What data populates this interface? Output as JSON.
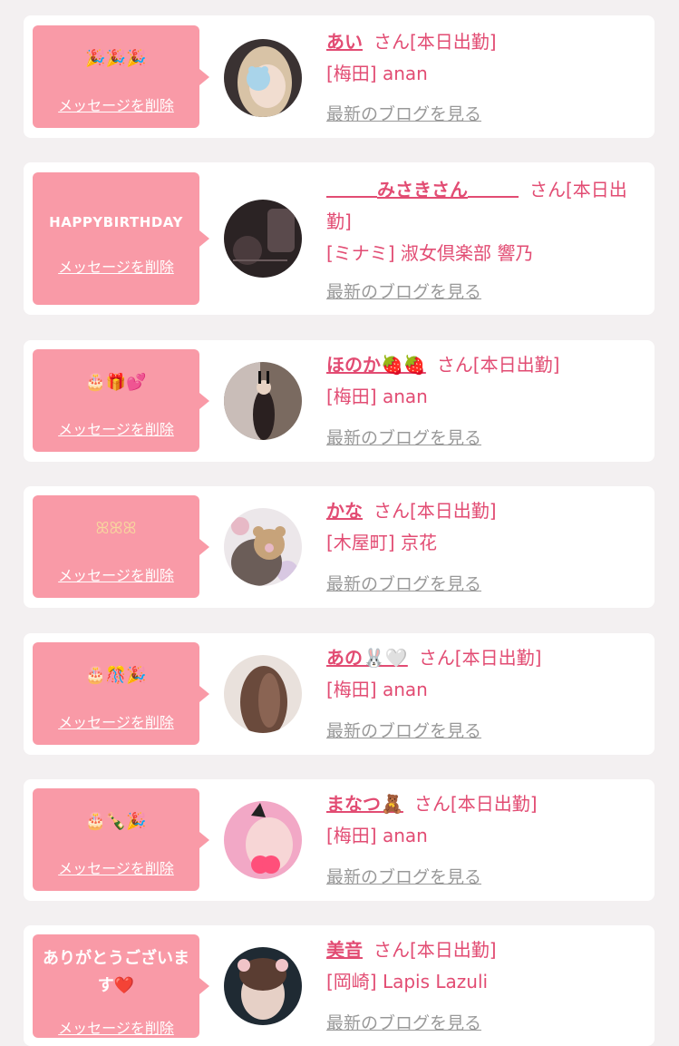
{
  "colors": {
    "bubble": "#f99aa7",
    "accent": "#e24c73",
    "link_gray": "#999999",
    "card": "#ffffff",
    "page_bg": "#f3f0f1"
  },
  "delete_label": "メッセージを削除",
  "blog_label": "最新のブログを見る",
  "suffix": "さん[本日出勤]",
  "cards": [
    {
      "message": "🎉🎉🎉",
      "name": "あい",
      "shop": "[梅田] anan",
      "avatar_icon": "blonde-woman-bear-sticker-photo"
    },
    {
      "message": "HAPPYBIRTHDAY",
      "name": "みさきさん",
      "shop": "[ミナミ] 淑女倶楽部 響乃",
      "avatar_icon": "dark-night-photo"
    },
    {
      "message": "🎂🎁💕",
      "name": "ほのか🍓🍓",
      "shop": "[梅田] anan",
      "avatar_icon": "bunny-ears-mirror-photo"
    },
    {
      "message": "ꕤꕤꕤ",
      "name": "かな",
      "shop": "[木屋町] 京花",
      "avatar_icon": "teddy-bear-sticker-photo"
    },
    {
      "message": "🎂🎊🎉",
      "name": "あの🐰🤍",
      "shop": "[梅田] anan",
      "avatar_icon": "long-brown-hair-photo"
    },
    {
      "message": "🎂🍾🎉",
      "name": "まなつ🧸",
      "shop": "[梅田] anan",
      "avatar_icon": "pink-sparkle-cat-ears-photo"
    },
    {
      "message": "ありがとうございます❤️",
      "name": "美音",
      "shop": "[岡崎] Lapis Lazuli",
      "avatar_icon": "ear-filter-selfie-photo"
    }
  ]
}
